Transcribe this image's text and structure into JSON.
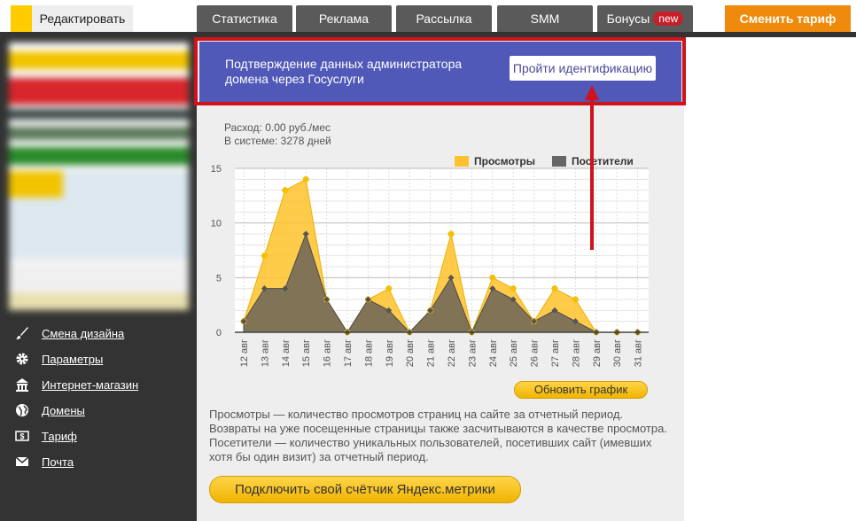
{
  "tabs": {
    "edit": "Редактировать",
    "items": [
      "Статистика",
      "Реклама",
      "Рассылка",
      "SMM",
      "Бонусы"
    ],
    "new_badge": "new",
    "tariff": "Сменить тариф"
  },
  "sidebar": {
    "items": [
      {
        "label": "Смена дизайна",
        "icon": "brush-icon"
      },
      {
        "label": "Параметры",
        "icon": "gear-icon"
      },
      {
        "label": "Интернет-магазин",
        "icon": "shop-icon"
      },
      {
        "label": "Домены",
        "icon": "globe-icon"
      },
      {
        "label": "Тариф",
        "icon": "dollar-icon"
      },
      {
        "label": "Почта",
        "icon": "mail-icon"
      }
    ]
  },
  "verify": {
    "text": "Подтверждение данных администратора домена через Госуслуги",
    "button": "Пройти идентификацию"
  },
  "info": {
    "expense": "Расход: 0.00 руб./мес",
    "days": "В системе: 3278 дней"
  },
  "chart_data": {
    "type": "area",
    "x": [
      "12 авг",
      "13 авг",
      "14 авг",
      "15 авг",
      "16 авг",
      "17 авг",
      "18 авг",
      "19 авг",
      "20 авг",
      "21 авг",
      "22 авг",
      "23 авг",
      "24 авг",
      "25 авг",
      "26 авг",
      "27 авг",
      "28 авг",
      "29 авг",
      "30 авг",
      "31 авг"
    ],
    "series": [
      {
        "name": "Просмотры",
        "color": "#ffc22a",
        "values": [
          1,
          7,
          13,
          14,
          3,
          0,
          3,
          4,
          0,
          2,
          9,
          0,
          5,
          4,
          1,
          4,
          3,
          0,
          0,
          0
        ]
      },
      {
        "name": "Посетители",
        "color": "#666666",
        "values": [
          1,
          4,
          4,
          9,
          3,
          0,
          3,
          2,
          0,
          2,
          5,
          0,
          4,
          3,
          1,
          2,
          1,
          0,
          0,
          0
        ]
      }
    ],
    "ylim": [
      0,
      15
    ],
    "yticks": [
      0,
      5,
      10,
      15
    ],
    "grid": true,
    "legend": "top-right"
  },
  "update_button": "Обновить график",
  "description": "Просмотры — количество просмотров страниц на сайте за отчетный период. Возвраты на уже посещенные страницы также засчитываются в качестве просмотра. Посетители — количество уникальных пользователей, посетивших сайт (имевших хотя бы один визит) за отчетный период.",
  "metrika_button": "Подключить свой счётчик Яндекс.метрики",
  "colors": {
    "accent": "#ffc22a",
    "banner": "#5058b8",
    "highlight": "#d2121b",
    "sidebar": "#333333"
  }
}
